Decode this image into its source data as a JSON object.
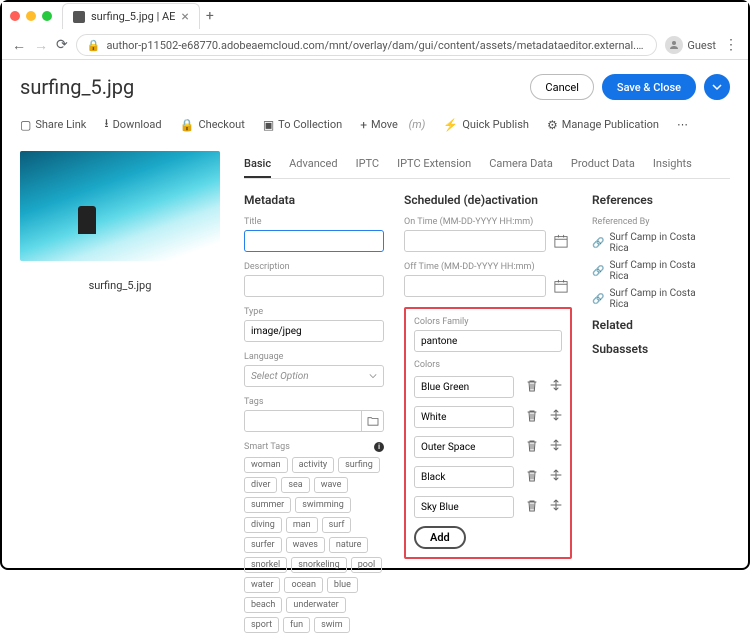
{
  "browser": {
    "tab_title": "surfing_5.jpg | AE",
    "url": "author-p11502-e68770.adobeaemcloud.com/mnt/overlay/dam/gui/content/assets/metadataeditor.external.html?item=/content/dam/wknd/en/advent…",
    "guest": "Guest"
  },
  "header": {
    "title": "surfing_5.jpg",
    "cancel": "Cancel",
    "save": "Save & Close"
  },
  "toolbar": {
    "share": "Share Link",
    "download": "Download",
    "checkout": "Checkout",
    "collection": "To Collection",
    "move": "Move",
    "move_hint": "(m)",
    "quickpub": "Quick Publish",
    "managepub": "Manage Publication"
  },
  "thumb_caption": "surfing_5.jpg",
  "tabs": [
    "Basic",
    "Advanced",
    "IPTC",
    "IPTC Extension",
    "Camera Data",
    "Product Data",
    "Insights"
  ],
  "meta": {
    "heading": "Metadata",
    "title_label": "Title",
    "desc_label": "Description",
    "type_label": "Type",
    "type_value": "image/jpeg",
    "lang_label": "Language",
    "lang_value": "Select Option",
    "tags_label": "Tags",
    "smart_label": "Smart Tags",
    "smart_tags": [
      "woman",
      "activity",
      "surfing",
      "diver",
      "sea",
      "wave",
      "summer",
      "swimming",
      "diving",
      "man",
      "surf",
      "surfer",
      "waves",
      "nature",
      "snorkel",
      "snorkeling",
      "pool",
      "water",
      "ocean",
      "blue",
      "beach",
      "underwater",
      "sport",
      "fun",
      "swim"
    ]
  },
  "sched": {
    "heading": "Scheduled (de)activation",
    "on_label": "On Time (MM-DD-YYYY HH:mm)",
    "off_label": "Off Time (MM-DD-YYYY HH:mm)",
    "cf_label": "Colors Family",
    "cf_value": "pantone",
    "colors_label": "Colors",
    "colors": [
      "Blue Green",
      "White",
      "Outer Space",
      "Black",
      "Sky Blue"
    ],
    "add": "Add"
  },
  "refs": {
    "heading": "References",
    "refby_label": "Referenced By",
    "items": [
      "Surf Camp in Costa Rica",
      "Surf Camp in Costa Rica",
      "Surf Camp in Costa Rica"
    ],
    "related": "Related",
    "subassets": "Subassets"
  }
}
